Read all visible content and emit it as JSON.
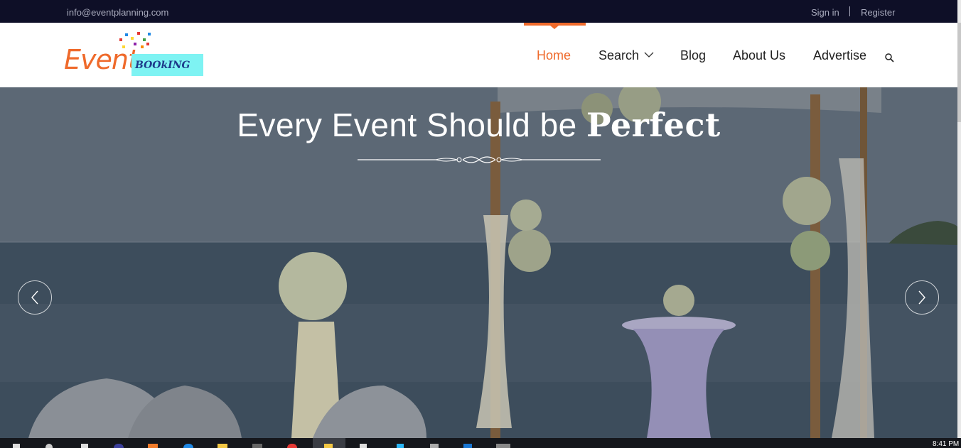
{
  "topbar": {
    "email": "info@eventplanning.com",
    "signin": "Sign in",
    "register": "Register"
  },
  "logo": {
    "word1": "Event",
    "word2": "BOOkING"
  },
  "nav": {
    "items": [
      {
        "label": "Home",
        "active": true
      },
      {
        "label": "Search",
        "dropdown": true
      },
      {
        "label": "Blog"
      },
      {
        "label": "About Us"
      },
      {
        "label": "Advertise"
      }
    ],
    "search_icon": "search-icon"
  },
  "hero": {
    "title_regular": "Every Event Should be",
    "title_bold": "Perfect",
    "prev_icon": "chevron-left-icon",
    "next_icon": "chevron-right-icon"
  },
  "taskbar": {
    "clock": "8:41 PM"
  },
  "colors": {
    "accent": "#ef6a2b",
    "topbar_bg": "#0e0f27",
    "logo_box": "#7ef3f3",
    "logo_text": "#1e3a8a"
  }
}
